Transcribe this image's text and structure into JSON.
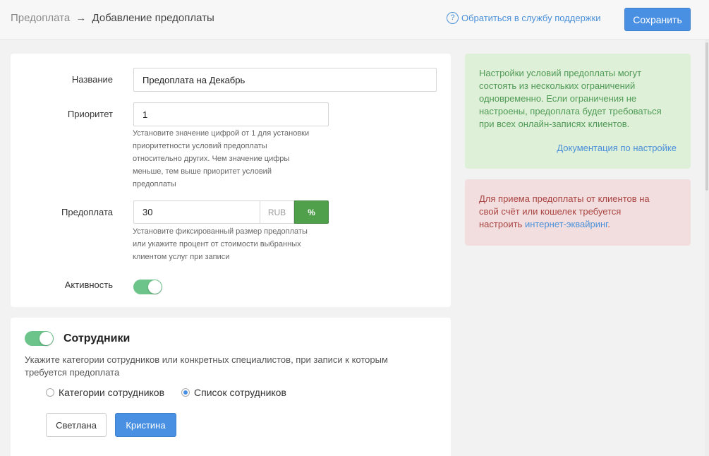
{
  "header": {
    "breadcrumb_parent": "Предоплата",
    "breadcrumb_arrow": "→",
    "breadcrumb_current": "Добавление предоплаты",
    "support_icon": "?",
    "support_link": "Обратиться в службу поддержки",
    "save_label": "Сохранить"
  },
  "form": {
    "name_label": "Название",
    "name_value": "Предоплата на Декабрь",
    "priority_label": "Приоритет",
    "priority_value": "1",
    "priority_hint": [
      "Установите значение цифрой от 1 для установки",
      "приоритетности условий предоплаты",
      "относительно других. Чем значение цифры",
      "меньше, тем выше приоритет условий",
      "предоплаты"
    ],
    "prepay_label": "Предоплата",
    "prepay_value": "30",
    "prepay_unit_rub": "RUB",
    "prepay_unit_pct": "%",
    "prepay_hint": [
      "Установите фиксированный размер предоплаты",
      "или укажите процент от стоимости выбранных",
      "клиентом услуг при записи"
    ],
    "active_label": "Активность",
    "active_on": true
  },
  "staff": {
    "toggle_on": true,
    "title": "Сотрудники",
    "description_lines": [
      "Укажите категории сотрудников или конкретных специалистов, при записи к которым",
      "требуется предоплата"
    ],
    "radio_categories": "Категории сотрудников",
    "radio_list": "Список сотрудников",
    "selected_radio": "list",
    "employees": [
      {
        "name": "Светлана",
        "selected": false
      },
      {
        "name": "Кристина",
        "selected": true
      }
    ]
  },
  "info_green": {
    "lines": [
      "Настройки условий предоплаты могут",
      "состоять из нескольких ограничений",
      "одновременно. Если ограничения не",
      "настроены, предоплата будет требоваться",
      "при всех онлайн-записях клиентов."
    ],
    "link": "Документация по настройке"
  },
  "info_red": {
    "line1": "Для приема предоплаты от клиентов на",
    "line2": "свой счёт или кошелек требуется",
    "line3_prefix": "настроить ",
    "line3_link": "интернет-эквайринг",
    "line3_suffix": "."
  },
  "colors": {
    "primary": "#4a90e2",
    "success": "#4f9f4b",
    "toggle_on": "#6cc48a",
    "info_green_bg": "#dff0d8",
    "info_red_bg": "#f2dede"
  }
}
